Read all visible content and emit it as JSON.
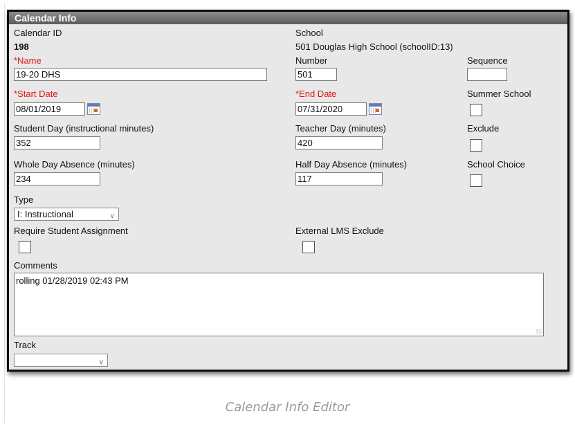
{
  "header": {
    "title": "Calendar Info"
  },
  "fields": {
    "calendar_id": {
      "label": "Calendar ID",
      "value": "198"
    },
    "school": {
      "label": "School",
      "value": "501 Douglas High School (schoolID:13)"
    },
    "name": {
      "label": "*Name",
      "value": "19-20 DHS"
    },
    "number": {
      "label": "Number",
      "value": "501"
    },
    "sequence": {
      "label": "Sequence",
      "value": ""
    },
    "start_date": {
      "label": "*Start Date",
      "value": "08/01/2019"
    },
    "end_date": {
      "label": "*End Date",
      "value": "07/31/2020"
    },
    "summer_school": {
      "label": "Summer School",
      "checked": false
    },
    "student_day": {
      "label": "Student Day (instructional minutes)",
      "value": "352"
    },
    "teacher_day": {
      "label": "Teacher Day (minutes)",
      "value": "420"
    },
    "exclude": {
      "label": "Exclude",
      "checked": false
    },
    "whole_day_absence": {
      "label": "Whole Day Absence (minutes)",
      "value": "234"
    },
    "half_day_absence": {
      "label": "Half Day Absence (minutes)",
      "value": "117"
    },
    "school_choice": {
      "label": "School Choice",
      "checked": false
    },
    "type": {
      "label": "Type",
      "value": "I: Instructional"
    },
    "require_student_assignment": {
      "label": "Require Student Assignment",
      "checked": false
    },
    "external_lms_exclude": {
      "label": "External LMS Exclude",
      "checked": false
    },
    "comments": {
      "label": "Comments",
      "value": "rolling 01/28/2019 02:43 PM"
    },
    "track": {
      "label": "Track",
      "value": ""
    }
  },
  "icons": {
    "calendar": "calendar-icon",
    "dropdown": "chevron-down-icon",
    "resize": "resize-grip-icon"
  },
  "colors": {
    "required": "#e21414",
    "header": "#6e6e6e",
    "panel": "#e8e8e8"
  },
  "caption": "Calendar Info Editor"
}
